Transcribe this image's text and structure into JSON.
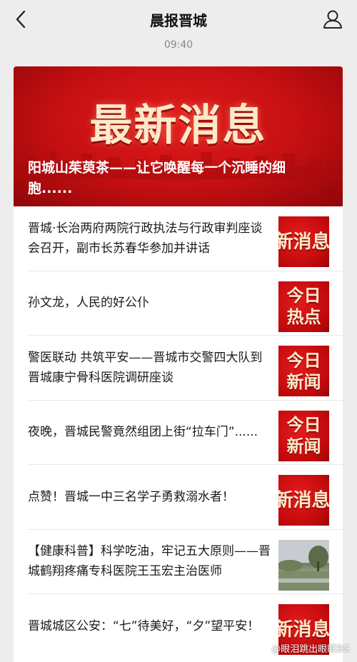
{
  "header": {
    "title": "晨报晋城",
    "back_icon": "chevron-left-icon",
    "user_icon": "user-icon"
  },
  "time": "09:40",
  "banner": {
    "headline_word": "最新消息",
    "caption": "阳城山茱萸茶——让它唤醒每一个沉睡的细胞......"
  },
  "articles": [
    {
      "title": "晋城·长治两府两院行政执法与行政审判座谈会召开，副市长苏春华参加并讲话",
      "thumb_text": "最新消息",
      "thumb_type": "wide"
    },
    {
      "title": "孙文龙，人民的好公仆",
      "thumb_text": "今日热点",
      "thumb_type": "square"
    },
    {
      "title": "警医联动 共筑平安——晋城市交警四大队到晋城康宁骨科医院调研座谈",
      "thumb_text": "今日新闻",
      "thumb_type": "square"
    },
    {
      "title": "夜晚，晋城民警竟然组团上街“拉车门”......",
      "thumb_text": "今日新闻",
      "thumb_type": "square"
    },
    {
      "title": "点赞！晋城一中三名学子勇救溺水者！",
      "thumb_text": "最新消息",
      "thumb_type": "wide"
    },
    {
      "title": "【健康科普】科学吃油，牢记五大原则——晋城鹤翔疼痛专科医院王玉宏主治医师",
      "thumb_text": "",
      "thumb_type": "photo"
    },
    {
      "title": "晋城城区公安：“七”待美好，“夕”望平安！",
      "thumb_text": "最新消息",
      "thumb_type": "wide"
    }
  ],
  "watermark": "@眼泪跳出眼眶BG"
}
